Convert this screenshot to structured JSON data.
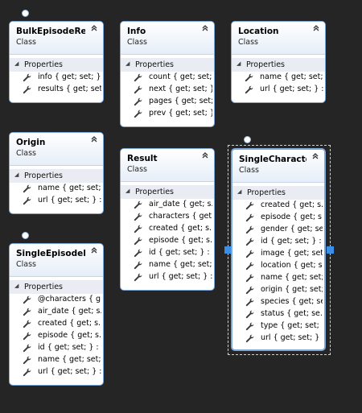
{
  "classes": [
    {
      "id": "bulk",
      "title": "BulkEpisodeRes...",
      "stereotype": "Class",
      "section": "Properties",
      "properties": [
        "info { get; set; }...",
        "results { get; set..."
      ]
    },
    {
      "id": "info",
      "title": "Info",
      "stereotype": "Class",
      "section": "Properties",
      "properties": [
        "count { get; set;...",
        "next { get; set; }...",
        "pages { get; set;...",
        "prev { get; set; }..."
      ]
    },
    {
      "id": "location",
      "title": "Location",
      "stereotype": "Class",
      "section": "Properties",
      "properties": [
        "name { get; set;...",
        "url { get; set; } :..."
      ]
    },
    {
      "id": "origin",
      "title": "Origin",
      "stereotype": "Class",
      "section": "Properties",
      "properties": [
        "name { get; set;...",
        "url { get; set; } :..."
      ]
    },
    {
      "id": "result",
      "title": "Result",
      "stereotype": "Class",
      "section": "Properties",
      "properties": [
        "air_date { get; s...",
        "characters { get...",
        "created { get; s...",
        "episode { get; s...",
        "id { get; set; } : int",
        "name { get; set;...",
        "url { get; set; } :..."
      ]
    },
    {
      "id": "singlechar",
      "title": "SingleCharacter...",
      "stereotype": "Class",
      "section": "Properties",
      "properties": [
        "created { get; s...",
        "episode { get; s...",
        "gender { get; se...",
        "id { get; set; } : int",
        "image { get; set...",
        "location { get; s...",
        "name { get; set;...",
        "origin { get; set;...",
        "species { get; se...",
        "status { get; se...",
        "type { get; set; }...",
        "url { get; set; } :..."
      ]
    },
    {
      "id": "singleep",
      "title": "SingleEpisodeRe...",
      "stereotype": "Class",
      "section": "Properties",
      "properties": [
        "@characters { g...",
        "air_date { get; s...",
        "created { get; s...",
        "episode { get; s...",
        "id { get; set; } : int",
        "name { get; set;...",
        "url { get; set; } :..."
      ]
    }
  ],
  "icons": {
    "collapse": "double-chevron-up-icon",
    "expand_triangle": "collapse-triangle-icon",
    "property": "wrench-icon"
  },
  "colors": {
    "background": "#252526",
    "border": "#7ea8d8",
    "selection": "#3b8fe6"
  }
}
